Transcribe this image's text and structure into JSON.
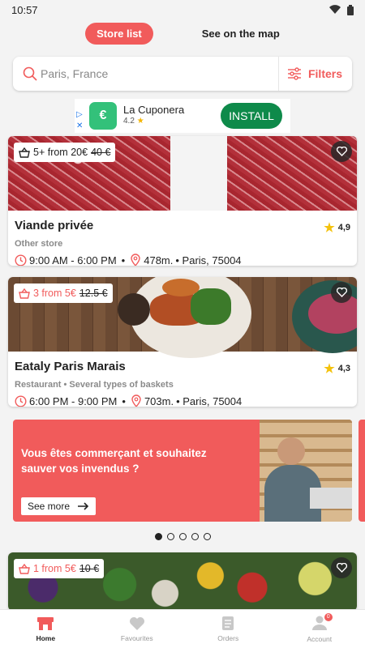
{
  "status_bar": {
    "time": "10:57"
  },
  "view_toggle": {
    "store_list_label": "Store list",
    "map_label": "See on the map"
  },
  "search": {
    "placeholder": "Paris, France",
    "filters_label": "Filters"
  },
  "ad": {
    "app_name": "La Cuponera",
    "rating": "4.2",
    "install_label": "INSTALL",
    "logo_glyph": "€"
  },
  "stores": [
    {
      "badge_count": "5+ from 20€",
      "badge_old_price": "40 €",
      "name": "Viande privée",
      "rating": "4,9",
      "category": "Other store",
      "hours": "9:00 AM - 6:00 PM",
      "distance": "478m.",
      "address": "• Paris, 75004"
    },
    {
      "badge_count": "3 from 5€",
      "badge_old_price": "12.5 €",
      "name": "Eataly Paris Marais",
      "rating": "4,3",
      "category": "Restaurant • Several types of baskets",
      "hours": "6:00 PM - 9:00 PM",
      "distance": "703m.",
      "address": "• Paris, 75004"
    },
    {
      "badge_count": "1 from 5€",
      "badge_old_price": "10 €"
    }
  ],
  "banner": {
    "text": "Vous êtes commerçant et souhaitez sauver vos invendus  ?",
    "button_label": "See more"
  },
  "carousel": {
    "pages": 5,
    "active": 1
  },
  "tabbar": {
    "home": "Home",
    "favourites": "Favourites",
    "orders": "Orders",
    "account": "Account",
    "account_badge": "0"
  },
  "colors": {
    "accent": "#f15b5b",
    "install": "#0e8a4a",
    "ad_logo": "#33c17a",
    "star": "#f4c20d"
  }
}
